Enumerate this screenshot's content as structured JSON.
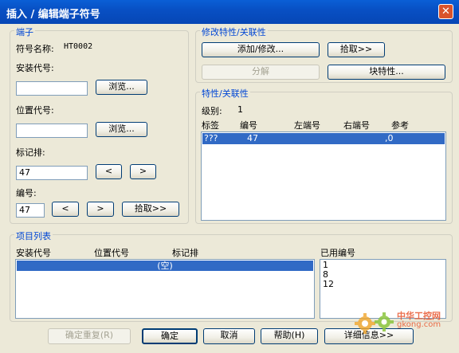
{
  "window": {
    "title": "插入 / 编辑端子符号",
    "close_label": "✕"
  },
  "terminal": {
    "legend": "端子",
    "symbol_name_label": "符号名称:",
    "symbol_name_value": "HT0002",
    "install_code_label": "安装代号:",
    "install_code_value": "",
    "browse1_label": "浏览...",
    "location_code_label": "位置代号:",
    "location_code_value": "",
    "browse2_label": "浏览...",
    "tag_strip_label": "标记排:",
    "tag_strip_value": "47",
    "prev1_label": "<",
    "next1_label": ">",
    "number_label": "编号:",
    "number_value": "47",
    "prev2_label": "<",
    "next2_label": ">",
    "pick_label": "拾取>>"
  },
  "modify": {
    "legend": "修改特性/关联性",
    "add_modify_label": "添加/修改...",
    "pick_label": "拾取>>",
    "split_label": "分解",
    "block_props_label": "块特性..."
  },
  "props": {
    "legend": "特性/关联性",
    "level_label": "级别:",
    "level_value": "1",
    "columns": [
      "标签",
      "编号",
      "左端号",
      "右端号",
      "参考"
    ],
    "rows": [
      {
        "tag": "???",
        "number": "47",
        "left": "",
        "right": "",
        "ref": ",0"
      }
    ]
  },
  "items": {
    "legend": "项目列表",
    "columns": [
      "安装代号",
      "位置代号",
      "标记排"
    ],
    "rows": [
      {
        "text": "(空)"
      }
    ],
    "used_label": "已用编号",
    "used_numbers": [
      "1",
      "8",
      "12"
    ]
  },
  "footer": {
    "repeat_label": "确定重复(R)",
    "ok_label": "确定",
    "cancel_label": "取消",
    "help_label": "帮助(H)",
    "details_label": "详细信息>>"
  },
  "watermark": {
    "text": "中华工控网",
    "url": "gkong.com"
  }
}
